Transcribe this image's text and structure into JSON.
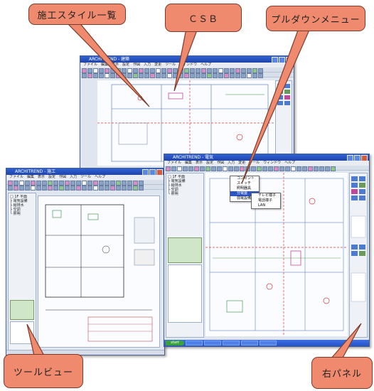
{
  "callouts": {
    "style_list": "施工スタイル一覧",
    "csb": "ＣＳＢ",
    "pulldown": "プルダウンメニュー",
    "tool_view": "ツールビュー",
    "right_panel": "右パネル"
  },
  "windows": {
    "back_title": "ARCHITREND - 建築",
    "left_title": "ARCHITREND - 施工",
    "right_title": "ARCHITREND - 電気"
  },
  "menu": [
    "ファイル",
    "編集",
    "表示",
    "設定",
    "作図",
    "入力",
    "変更",
    "ツール",
    "ウィンドウ",
    "ヘルプ"
  ],
  "tree_items": [
    "□ 1F 平面",
    "├ 電気設備",
    "├ 給排水",
    "├ 空調",
    "└ 照明"
  ],
  "dropdown_items": [
    "コンセント",
    "スイッチ",
    "照明器具",
    "分電盤",
    "弱電設備",
    "テレビ端子",
    "電話端子",
    "LAN"
  ],
  "taskbar": {
    "start": "start"
  },
  "colors": {
    "callout": "#f08a6e",
    "titlebar": "#2f62d8",
    "drawing_line": "#d23b3b",
    "panel": "#eef2f7"
  }
}
